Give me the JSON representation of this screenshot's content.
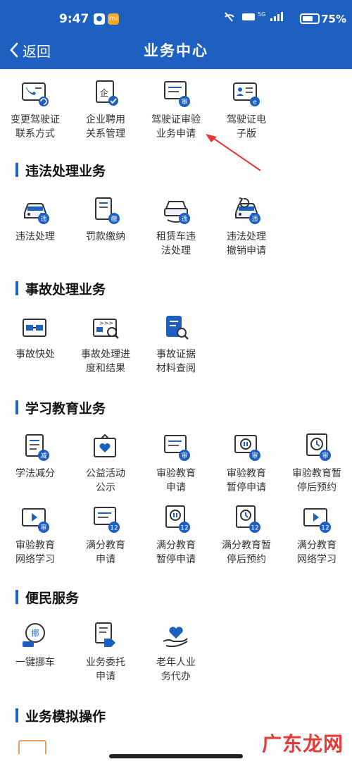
{
  "status_bar": {
    "time": "9:47",
    "network": "5G",
    "battery": "75%",
    "battery_level": 0.75
  },
  "header": {
    "back_label": "返回",
    "title": "业务中心"
  },
  "top_items": [
    {
      "label": "变更驾驶证\n联系方式",
      "icon": "license-contact-icon"
    },
    {
      "label": "企业聘用\n关系管理",
      "icon": "enterprise-doc-icon"
    },
    {
      "label": "驾驶证审验\n业务申请",
      "icon": "license-review-icon"
    },
    {
      "label": "驾驶证电\n子版",
      "icon": "e-license-icon"
    }
  ],
  "sections": [
    {
      "title": "违法处理业务",
      "items": [
        {
          "label": "违法处理",
          "icon": "car-violation-icon"
        },
        {
          "label": "罚款缴纳",
          "icon": "fine-payment-icon"
        },
        {
          "label": "租赁车违\n法处理",
          "icon": "rental-car-icon"
        },
        {
          "label": "违法处理\n撤销申请",
          "icon": "revoke-violation-icon"
        }
      ]
    },
    {
      "title": "事故处理业务",
      "items": [
        {
          "label": "事故快处",
          "icon": "quick-accident-icon"
        },
        {
          "label": "事故处理进\n度和结果",
          "icon": "accident-progress-icon"
        },
        {
          "label": "事故证据\n材料查阅",
          "icon": "evidence-lookup-icon"
        }
      ]
    },
    {
      "title": "学习教育业务",
      "items": [
        {
          "label": "学法减分",
          "icon": "study-reduce-points-icon"
        },
        {
          "label": "公益活动\n公示",
          "icon": "public-welfare-icon"
        },
        {
          "label": "审验教育\n申请",
          "icon": "review-education-icon"
        },
        {
          "label": "审验教育\n暂停申请",
          "icon": "review-pause-icon"
        },
        {
          "label": "审验教育暂\n停后预约",
          "icon": "review-appointment-icon"
        },
        {
          "label": "审验教育\n网络学习",
          "icon": "review-online-icon"
        },
        {
          "label": "满分教育\n申请",
          "icon": "full-score-apply-icon"
        },
        {
          "label": "满分教育\n暂停申请",
          "icon": "full-score-pause-icon"
        },
        {
          "label": "满分教育暂\n停后预约",
          "icon": "full-score-appointment-icon"
        },
        {
          "label": "满分教育\n网络学习",
          "icon": "full-score-online-icon"
        }
      ]
    },
    {
      "title": "便民服务",
      "items": [
        {
          "label": "一键挪车",
          "icon": "move-car-icon"
        },
        {
          "label": "业务委托\n申请",
          "icon": "entrust-icon"
        },
        {
          "label": "老年人业\n务代办",
          "icon": "elderly-service-icon"
        }
      ]
    },
    {
      "title": "业务模拟操作",
      "items": []
    }
  ],
  "watermark": "广东龙网",
  "colors": {
    "primary": "#1e5fc2",
    "accent": "#e53935"
  }
}
